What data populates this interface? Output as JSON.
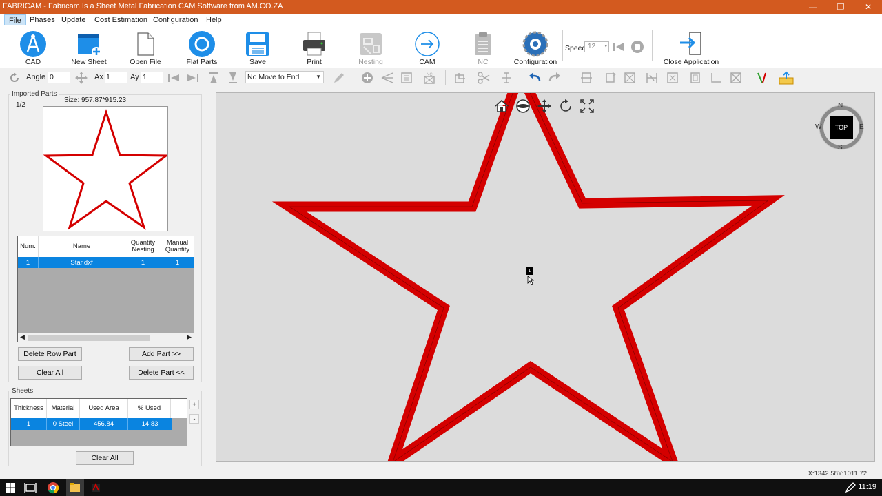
{
  "window": {
    "title": "FABRICAM - Fabricam Is a Sheet Metal Fabrication CAM Software from AM.CO.ZA",
    "minimize": "—",
    "restore": "❐",
    "close": "✕"
  },
  "menu": [
    "File",
    "Phases",
    "Update",
    "Cost Estimation",
    "Configuration",
    "Help"
  ],
  "ribbon": {
    "tools": [
      {
        "label": "CAD",
        "icon": "cad-compass-icon",
        "enabled": true
      },
      {
        "label": "New Sheet",
        "icon": "new-sheet-icon",
        "enabled": true
      },
      {
        "label": "Open File",
        "icon": "open-file-icon",
        "enabled": true
      },
      {
        "label": "Flat Parts",
        "icon": "flat-parts-icon",
        "enabled": true
      },
      {
        "label": "Save",
        "icon": "save-icon",
        "enabled": true
      },
      {
        "label": "Print",
        "icon": "printer-icon",
        "enabled": true
      },
      {
        "label": "Nesting",
        "icon": "nesting-icon",
        "enabled": false
      },
      {
        "label": "CAM",
        "icon": "cam-arrow-icon",
        "enabled": true
      },
      {
        "label": "NC",
        "icon": "nc-clipboard-icon",
        "enabled": false
      },
      {
        "label": "Configuration",
        "icon": "configuration-gear-icon",
        "enabled": true
      },
      {
        "label": "Close Application",
        "icon": "close-application-icon",
        "enabled": true
      }
    ],
    "speed_label": "Speed",
    "speed_value": "12"
  },
  "toolbar2": {
    "angle_label": "Angle",
    "angle_value": "0",
    "ax_label": "Ax",
    "ax_value": "1",
    "ay_label": "Ay",
    "ay_value": "1",
    "move_option": "No Move to End"
  },
  "imported_parts": {
    "group_label": "Imported Parts",
    "page": "1/2",
    "size": "Size: 957.87*915.23",
    "columns": [
      "Num.",
      "Name",
      "Quantity Nesting",
      "Manual Quantity"
    ],
    "rows": [
      {
        "num": "1",
        "name": "Star.dxf",
        "qty_nesting": "1",
        "manual_qty": "1"
      }
    ],
    "buttons": {
      "delete_row": "Delete Row Part",
      "add_part": "Add Part >>",
      "clear_all": "Clear All",
      "delete_part": "Delete Part <<"
    }
  },
  "sheets": {
    "group_label": "Sheets",
    "columns": [
      "Thickness",
      "Material",
      "Used Area",
      "% Used"
    ],
    "rows": [
      {
        "thickness": "1",
        "material": "0  Steel",
        "used_area": "456.84",
        "pct_used": "14.83"
      }
    ],
    "plus": "+",
    "minus": "-",
    "clear_all": "Clear All"
  },
  "canvas": {
    "marker": "1",
    "compass": {
      "n": "N",
      "s": "S",
      "e": "E",
      "w": "W",
      "center": "TOP"
    },
    "star_color": "#d40000"
  },
  "status": {
    "coords": "X:1342.58Y:1011.72"
  },
  "taskbar": {
    "time": "11:19"
  }
}
